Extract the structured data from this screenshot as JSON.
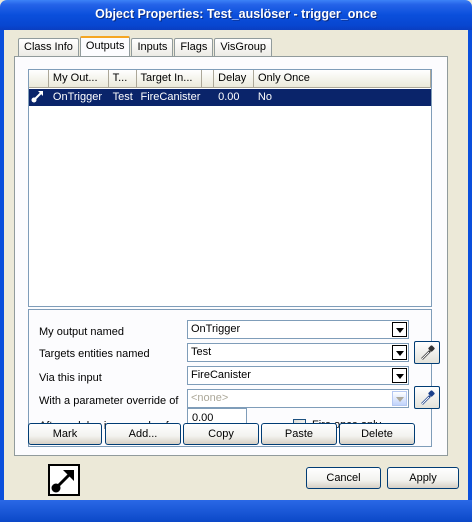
{
  "window": {
    "title": "Object Properties: Test_auslöser - trigger_once"
  },
  "tabs": [
    {
      "label": "Class Info",
      "active": false
    },
    {
      "label": "Outputs",
      "active": true
    },
    {
      "label": "Inputs",
      "active": false
    },
    {
      "label": "Flags",
      "active": false
    },
    {
      "label": "VisGroup",
      "active": false
    }
  ],
  "outputs_list": {
    "columns": [
      "",
      "My Out...",
      "T...",
      "Target In...",
      "",
      "Delay",
      "Only Once"
    ],
    "rows": [
      {
        "icon": "output-arrow-icon",
        "my_output": "OnTrigger",
        "target": "Test",
        "target_input": "FireCanister",
        "param": "",
        "delay": "0.00",
        "only_once": "No"
      }
    ]
  },
  "form": {
    "output_label": "My output named",
    "output_value": "OnTrigger",
    "targets_label": "Targets entities named",
    "targets_value": "Test",
    "input_label": "Via this input",
    "input_value": "FireCanister",
    "param_label": "With a parameter override of",
    "param_value": "<none>",
    "delay_label": "After a delay in seconds of",
    "delay_value": "0.00",
    "fire_once_label": "Fire once only"
  },
  "actions": {
    "mark": "Mark",
    "add": "Add...",
    "copy": "Copy",
    "paste": "Paste",
    "delete": "Delete"
  },
  "footer": {
    "cancel": "Cancel",
    "apply": "Apply"
  }
}
